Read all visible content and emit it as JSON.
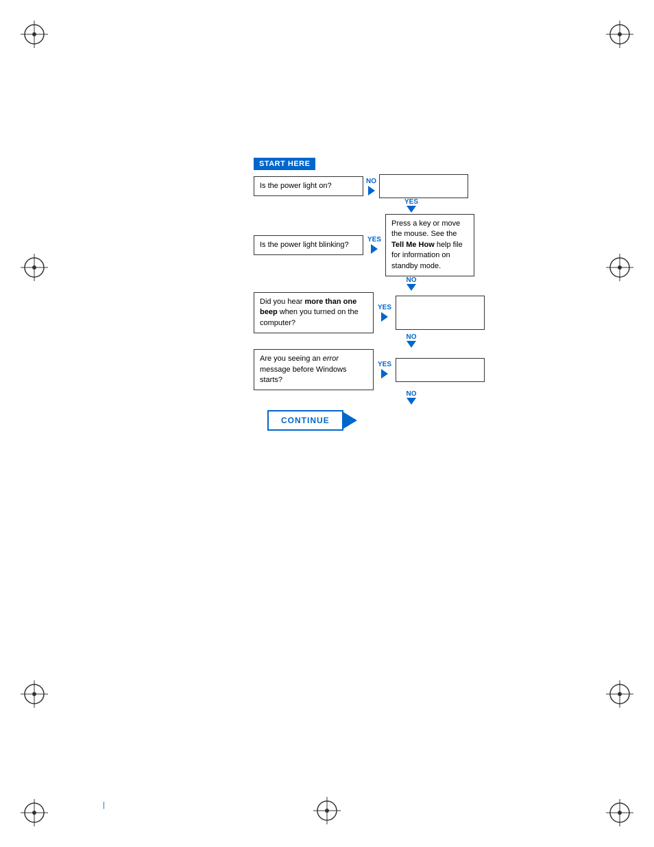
{
  "page": {
    "background": "#ffffff",
    "page_number": "|"
  },
  "flowchart": {
    "start_label": "START HERE",
    "questions": [
      {
        "id": "q1",
        "text": "Is the power light on?",
        "yes_label": "YES",
        "no_label": "NO",
        "yes_answer": "",
        "no_answer": ""
      },
      {
        "id": "q2",
        "text": "Is the power light blinking?",
        "yes_label": "YES",
        "no_label": "NO",
        "yes_answer": "Press a key or move the mouse. See the Tell Me How help file for information on standby mode.",
        "yes_answer_bold": "Tell Me How",
        "no_answer": ""
      },
      {
        "id": "q3",
        "text": "Did you hear more than one beep when you turned on the computer?",
        "yes_label": "YES",
        "no_label": "NO",
        "yes_answer": "",
        "no_answer": ""
      },
      {
        "id": "q4",
        "text": "Are you seeing an error message before Windows starts?",
        "yes_label": "YES",
        "no_label": "NO",
        "yes_answer": "",
        "no_answer": ""
      }
    ],
    "continue_label": "CONTINUE"
  }
}
